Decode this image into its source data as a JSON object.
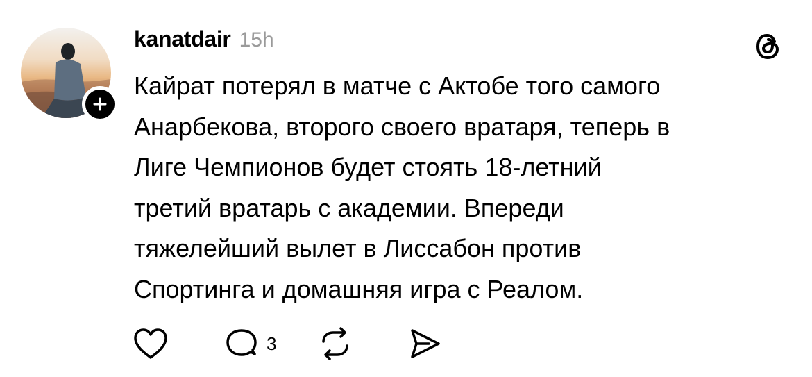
{
  "post": {
    "username": "kanatdair",
    "timestamp": "15h",
    "text": "Кайрат потерял в матче с Актобе того самого\nАнарбекова, второго своего вратаря, теперь в\nЛиге Чемпионов будет стоять 18-летний\nтретий вратарь с академии. Впереди\nтяжелейший вылет в Лиссабон против\nСпортинга и домашняя игра с Реалом.",
    "reply_count": "3"
  },
  "icons": {
    "follow": "plus-icon",
    "brand": "threads-logo-icon",
    "like": "heart-icon",
    "reply": "comment-bubble-icon",
    "repost": "repost-icon",
    "share": "send-icon"
  },
  "colors": {
    "text": "#000000",
    "timestamp": "#9a9a9a",
    "background": "#ffffff"
  }
}
